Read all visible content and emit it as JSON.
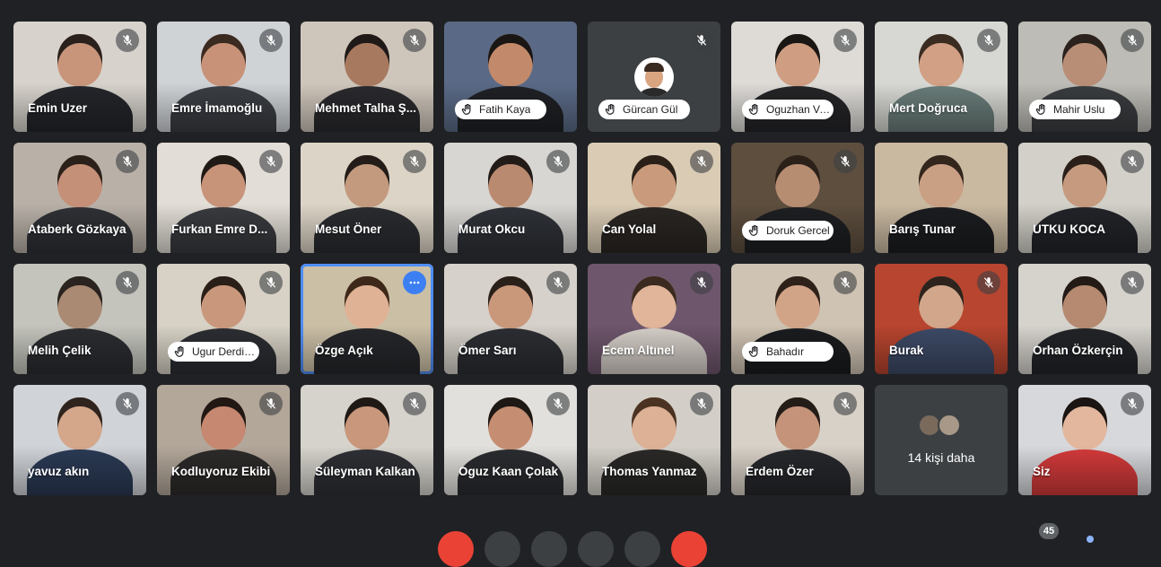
{
  "participants": [
    {
      "name": "Emin Uzer",
      "muted": true,
      "bg": "#d7d2cc",
      "skin": "#c8957a",
      "hair": "#2b211c",
      "shirt": "#24262b"
    },
    {
      "name": "Emre İmamoğlu",
      "muted": true,
      "bg": "#cfd3d6",
      "skin": "#c89278",
      "hair": "#3b2a20",
      "shirt": "#3b3e44"
    },
    {
      "name": "Mehmet Talha Ş...",
      "muted": true,
      "bg": "#cfc6bb",
      "skin": "#a77a60",
      "hair": "#1f1a18",
      "shirt": "#2a2a2e"
    },
    {
      "name": "Fatih Kaya",
      "hand": true,
      "bg": "#5a6a86",
      "skin": "#c28a6a",
      "hair": "#1a1614",
      "shirt": "#1f2125"
    },
    {
      "name": "Gürcan Gül",
      "hand": true,
      "muted": true,
      "avatar": true
    },
    {
      "name": "Oguzhan Va...",
      "hand": true,
      "muted": true,
      "bg": "#dedbd7",
      "skin": "#cf9d81",
      "hair": "#1a1614",
      "shirt": "#252528"
    },
    {
      "name": "Mert Doğruca",
      "muted": true,
      "bg": "#d7d8d3",
      "skin": "#d1a085",
      "hair": "#3b2c22",
      "shirt": "#6a7d7a"
    },
    {
      "name": "Mahir Uslu",
      "hand": true,
      "muted": true,
      "bg": "#bdbcb6",
      "skin": "#b98e77",
      "hair": "#2b221d",
      "shirt": "#3a3d40"
    },
    {
      "name": "Ataberk Gözkaya",
      "muted": true,
      "bg": "#b9b1a8",
      "skin": "#c59078",
      "hair": "#2c211a",
      "shirt": "#2f3136"
    },
    {
      "name": "Furkan Emre D...",
      "muted": true,
      "bg": "#e2ddd6",
      "skin": "#c79379",
      "hair": "#201a16",
      "shirt": "#3a3b3f"
    },
    {
      "name": "Mesut Öner",
      "muted": true,
      "bg": "#dcd4c6",
      "skin": "#c39a7e",
      "hair": "#231c18",
      "shirt": "#2b2c30"
    },
    {
      "name": "Murat Okcu",
      "muted": true,
      "bg": "#d8d6d3",
      "skin": "#b98a70",
      "hair": "#221b17",
      "shirt": "#2f3238"
    },
    {
      "name": "Can Yolal",
      "muted": true,
      "bg": "#d9cbb4",
      "skin": "#c99a7c",
      "hair": "#2b2018",
      "shirt": "#2a2623"
    },
    {
      "name": "Doruk Gercel",
      "hand": true,
      "muted": true,
      "bg": "#5d4e3e",
      "skin": "#b78d72",
      "hair": "#2b2119",
      "shirt": "#1e1f22"
    },
    {
      "name": "Barış Tunar",
      "bg": "#c9b9a1",
      "skin": "#caa085",
      "hair": "#33261d",
      "shirt": "#1c1d20"
    },
    {
      "name": "UTKU KOCA",
      "muted": true,
      "bg": "#d2d0c8",
      "skin": "#c69a7e",
      "hair": "#2a2019",
      "shirt": "#222429"
    },
    {
      "name": "Melih Çelik",
      "muted": true,
      "bg": "#c4c4bd",
      "skin": "#aa8a73",
      "hair": "#2a231f",
      "shirt": "#2c2d31"
    },
    {
      "name": "Ugur Derdim...",
      "hand": true,
      "muted": true,
      "bg": "#d8d2c6",
      "skin": "#c9987c",
      "hair": "#2a1f18",
      "shirt": "#2c2e33"
    },
    {
      "name": "Özge Açık",
      "active": true,
      "bg": "#cbbfa6",
      "skin": "#e0b295",
      "hair": "#3d2819",
      "shirt": "#26272b"
    },
    {
      "name": "Ömer Sarı",
      "muted": true,
      "bg": "#d6d1ca",
      "skin": "#c9977a",
      "hair": "#2a201a",
      "shirt": "#2c2e33"
    },
    {
      "name": "Ecem Altınel",
      "muted": true,
      "bg": "#6e566c",
      "skin": "#e1b59a",
      "hair": "#3a2a1f",
      "shirt": "#d6cfc9"
    },
    {
      "name": "Bahadır",
      "hand": true,
      "muted": true,
      "bg": "#cfc3b3",
      "skin": "#d2a487",
      "hair": "#2e2119",
      "shirt": "#1b1c1f"
    },
    {
      "name": "Burak",
      "muted": true,
      "bg": "#b8452f",
      "skin": "#d2a68a",
      "hair": "#2e241d",
      "shirt": "#3d4a66"
    },
    {
      "name": "Orhan Özkerçin",
      "muted": true,
      "bg": "#d6d3cd",
      "skin": "#b58a70",
      "hair": "#231a16",
      "shirt": "#222428"
    },
    {
      "name": "yavuz akın",
      "muted": true,
      "bg": "#d0d3d8",
      "skin": "#d4a68a",
      "hair": "#2e241d",
      "shirt": "#2b3a55"
    },
    {
      "name": "Kodluyoruz Ekibi",
      "muted": true,
      "bg": "#b3a79a",
      "skin": "#c68870",
      "hair": "#211813",
      "shirt": "#2d2b2a"
    },
    {
      "name": "Süleyman Kalkan",
      "muted": true,
      "bg": "#d6d3cc",
      "skin": "#c9977b",
      "hair": "#1f1915",
      "shirt": "#2f3035"
    },
    {
      "name": "Oguz Kaan Çolak",
      "muted": true,
      "bg": "#e2e0dc",
      "skin": "#c58e73",
      "hair": "#1e1814",
      "shirt": "#2b2c30"
    },
    {
      "name": "Thomas Yanmaz",
      "muted": true,
      "bg": "#d3cfc8",
      "skin": "#ddb196",
      "hair": "#4a3322",
      "shirt": "#2a2928"
    },
    {
      "name": "Erdem Özer",
      "muted": true,
      "bg": "#d8d1c7",
      "skin": "#c4937a",
      "hair": "#241c17",
      "shirt": "#27282c"
    },
    {
      "more": true,
      "label": "14 kişi daha"
    },
    {
      "name": "Siz",
      "muted": true,
      "bg": "#d6d8dc",
      "skin": "#e3b79e",
      "hair": "#1a1412",
      "shirt": "#d43a3a"
    }
  ],
  "badge": {
    "count": "45"
  },
  "toolbar": [
    {
      "color": "#ea4335"
    },
    {
      "color": "#3c4043"
    },
    {
      "color": "#3c4043"
    },
    {
      "color": "#3c4043"
    },
    {
      "color": "#3c4043"
    },
    {
      "color": "#ea4335"
    }
  ]
}
